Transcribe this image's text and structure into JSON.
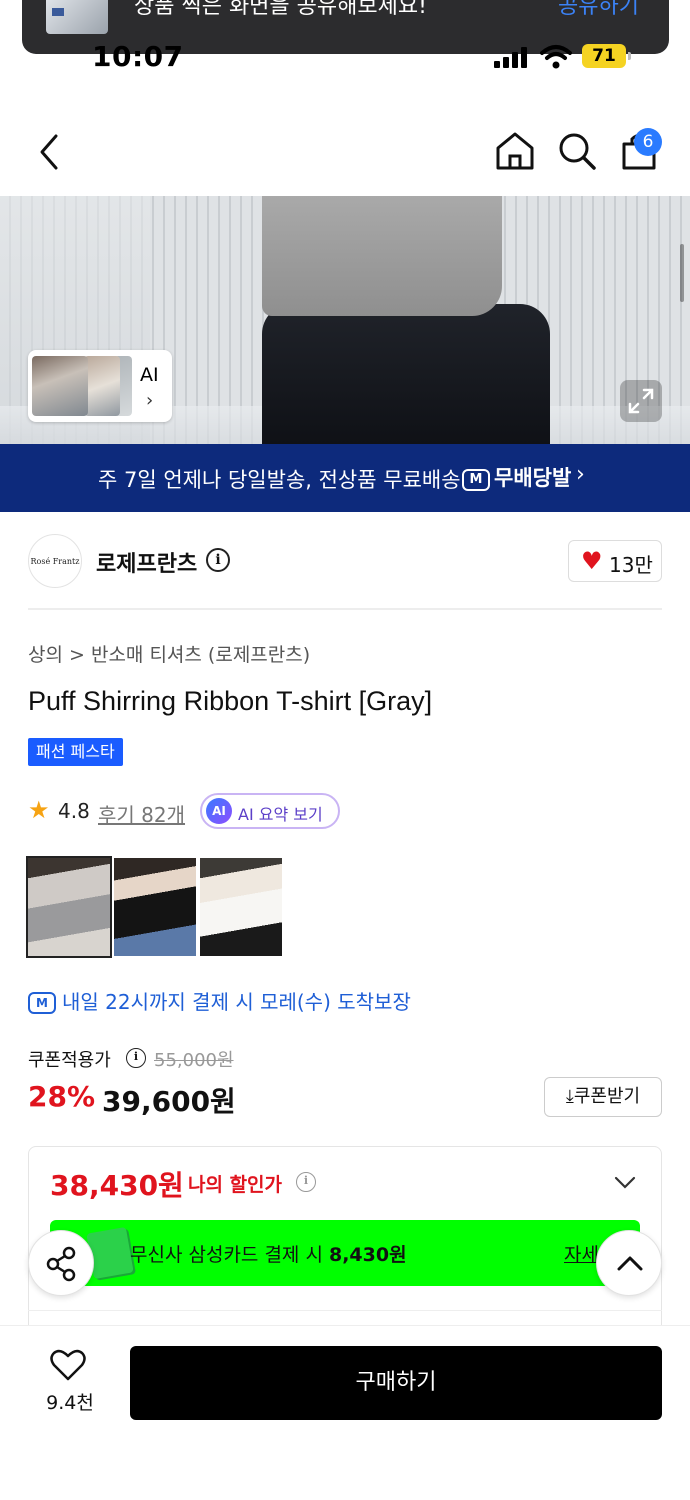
{
  "notification": {
    "message": "상품 찍은 화면을 공유해보세요!",
    "action": "공유하기"
  },
  "status_bar": {
    "time": "10:07",
    "battery": "71"
  },
  "nav": {
    "cart_count": "6"
  },
  "hero": {
    "ai_label": "AI",
    "ai_chevron": "›"
  },
  "promo": {
    "text": "주 7일 언제나 당일발송, 전상품 무료배송",
    "logo_mark": "M",
    "logo_text": "무배당발",
    "chevron": "›"
  },
  "brand": {
    "logo_text": "Rosé Frantz",
    "name": "로제프란츠",
    "info": "i",
    "likes": "13만"
  },
  "breadcrumb": {
    "category": "상의",
    "separator": " > ",
    "subcategory": "반소매 티셔츠 (로제프란츠)"
  },
  "product": {
    "title": "Puff Shirring Ribbon T-shirt [Gray]",
    "tag": "패션 페스타",
    "rating": "4.8",
    "reviews": "후기 82개",
    "ai_badge": "AI",
    "ai_summary": "AI 요약 보기"
  },
  "delivery": {
    "badge": "M",
    "text": "내일 22시까지 결제 시 모레(수) 도착보장"
  },
  "price": {
    "coupon_label": "쿠폰적용가",
    "info": "i",
    "original": "55,000원",
    "discount": "28%",
    "sale": "39,600원",
    "coupon_button": "⤓쿠폰받기"
  },
  "my_price": {
    "value": "38,430원",
    "label": "나의 할인가",
    "info": "i",
    "card_text_prefix": "무신사 삼성카드 결제 시 ",
    "card_text_amount": "8,430원",
    "detail": "자세히"
  },
  "bottom": {
    "wish_count": "9.4천",
    "buy_label": "구매하기"
  },
  "colors": {
    "accent_red": "#e0141e",
    "brand_blue": "#0d2a7c",
    "link_blue": "#1f5fd6",
    "tag_blue": "#1a5cff",
    "highlight_green": "#00ff00"
  },
  "icons": [
    "back-chevron-icon",
    "home-icon",
    "search-icon",
    "shopping-bag-icon",
    "expand-icon",
    "heart-icon",
    "star-icon",
    "truck-icon",
    "download-icon",
    "chevron-down-icon",
    "share-icon",
    "chevron-up-icon"
  ]
}
